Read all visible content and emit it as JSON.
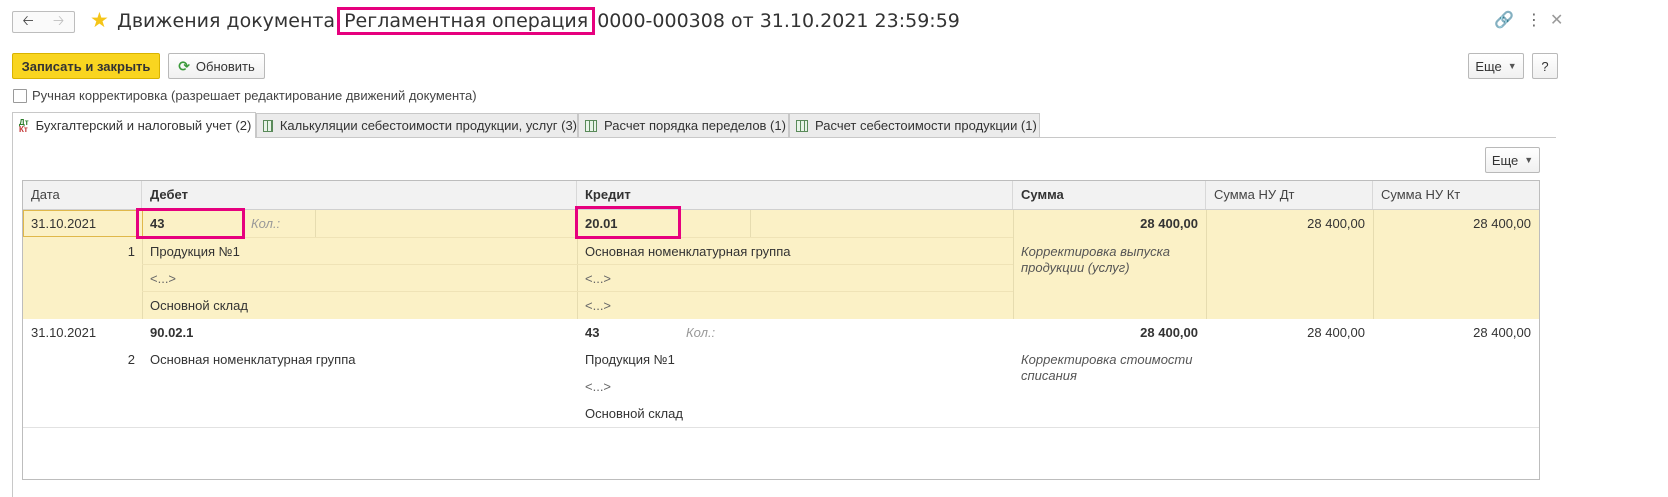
{
  "window": {
    "title_prefix": "Движения документа",
    "title_highlight": "Регламентная операция",
    "title_suffix": "0000-000308 от 31.10.2021 23:59:59",
    "icons": {
      "back": "arrow-left-icon",
      "forward": "arrow-right-icon",
      "favorite": "star-icon",
      "link": "link-icon",
      "more": "more-vertical-icon",
      "close": "close-icon"
    }
  },
  "toolbar": {
    "save_close_label": "Записать и закрыть",
    "refresh_label": "Обновить",
    "more_label": "Еще",
    "help_label": "?"
  },
  "manual_edit": {
    "label": "Ручная корректировка (разрешает редактирование движений документа)",
    "checked": false
  },
  "tabs": [
    {
      "label": "Бухгалтерский и налоговый учет (2)",
      "icon": "dt-kt-icon",
      "active": true
    },
    {
      "label": "Калькуляции себестоимости продукции, услуг (3)",
      "icon": "table-icon",
      "active": false
    },
    {
      "label": "Расчет порядка переделов (1)",
      "icon": "table-icon",
      "active": false
    },
    {
      "label": "Расчет себестоимости продукции (1)",
      "icon": "table-icon",
      "active": false
    }
  ],
  "tab_icon_dt": "Дт",
  "tab_icon_kt": "Кт",
  "panel": {
    "more_label": "Еще"
  },
  "table": {
    "columns": [
      "Дата",
      "Дебет",
      "Кредит",
      "Сумма",
      "Сумма НУ Дт",
      "Сумма НУ Кт"
    ],
    "rows": [
      {
        "date": "31.10.2021",
        "num": "1",
        "debit_account": "43",
        "debit_qty_label": "Кол.:",
        "debit_sub": [
          "Продукция №1",
          "<...>",
          "Основной склад"
        ],
        "credit_account": "20.01",
        "credit_sub": [
          "Основная номенклатурная группа",
          "<...>",
          "<...>"
        ],
        "amount": "28 400,00",
        "content": "Корректировка выпуска продукции (услуг)",
        "amount_nu_dt": "28 400,00",
        "amount_nu_kt": "28 400,00"
      },
      {
        "date": "31.10.2021",
        "num": "2",
        "debit_account": "90.02.1",
        "debit_sub": [
          "Основная номенклатурная группа"
        ],
        "credit_account": "43",
        "credit_qty_label": "Кол.:",
        "credit_sub": [
          "Продукция №1",
          "<...>",
          "Основной склад"
        ],
        "amount": "28 400,00",
        "content": "Корректировка стоимости списания",
        "amount_nu_dt": "28 400,00",
        "amount_nu_kt": "28 400,00"
      }
    ]
  }
}
